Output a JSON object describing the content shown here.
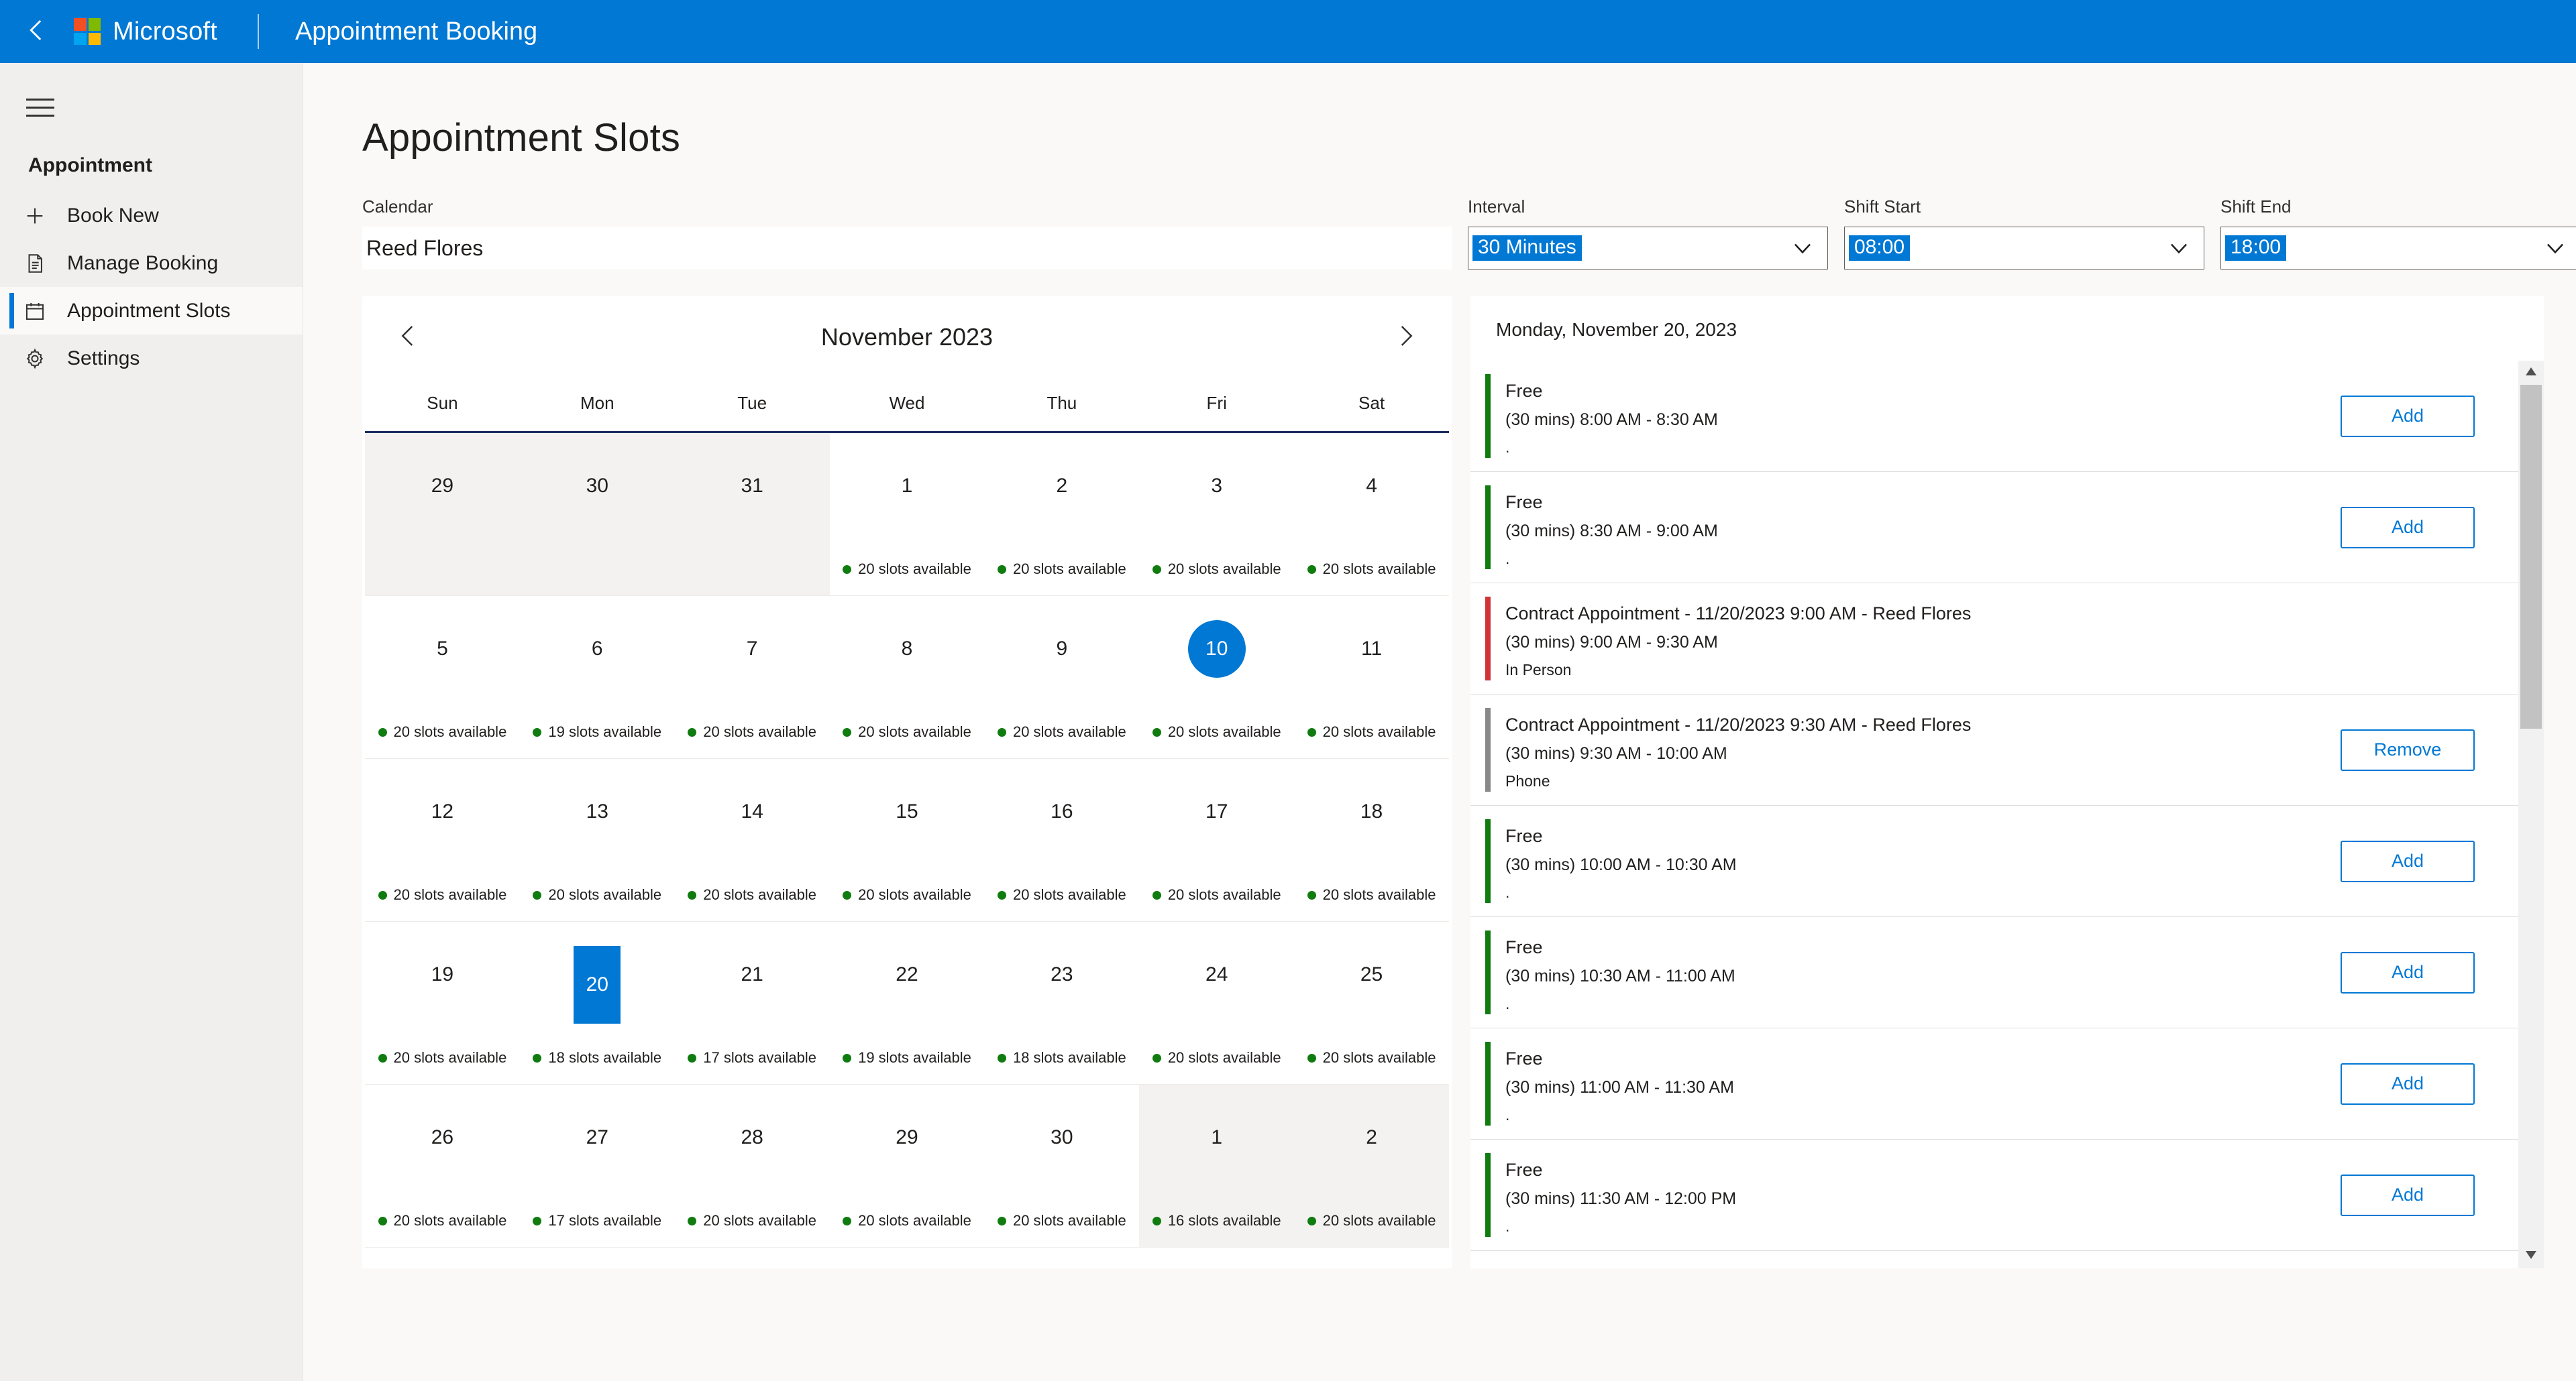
{
  "topbar": {
    "back_icon": "chevron-left-icon",
    "brand": "Microsoft",
    "app_title": "Appointment Booking"
  },
  "sidebar": {
    "menu_icon": "hamburger-icon",
    "heading": "Appointment",
    "items": [
      {
        "label": "Book New",
        "icon": "plus-icon",
        "active": false
      },
      {
        "label": "Manage Booking",
        "icon": "document-icon",
        "active": false
      },
      {
        "label": "Appointment Slots",
        "icon": "calendar-icon",
        "active": true
      },
      {
        "label": "Settings",
        "icon": "gear-icon",
        "active": false
      }
    ]
  },
  "page": {
    "title": "Appointment Slots"
  },
  "filters": {
    "calendar": {
      "label": "Calendar",
      "value": "Reed Flores"
    },
    "interval": {
      "label": "Interval",
      "value": "30 Minutes"
    },
    "shift_start": {
      "label": "Shift Start",
      "value": "08:00"
    },
    "shift_end": {
      "label": "Shift End",
      "value": "18:00"
    }
  },
  "calendar": {
    "prev_icon": "chevron-left-icon",
    "next_icon": "chevron-right-icon",
    "month_label": "November 2023",
    "day_names": [
      "Sun",
      "Mon",
      "Tue",
      "Wed",
      "Thu",
      "Fri",
      "Sat"
    ],
    "slots_suffix": "slots available",
    "weeks": [
      [
        {
          "day": "29",
          "other": true,
          "slots": null
        },
        {
          "day": "30",
          "other": true,
          "slots": null
        },
        {
          "day": "31",
          "other": true,
          "slots": null
        },
        {
          "day": "1",
          "other": false,
          "slots": "20 slots available"
        },
        {
          "day": "2",
          "other": false,
          "slots": "20 slots available"
        },
        {
          "day": "3",
          "other": false,
          "slots": "20 slots available"
        },
        {
          "day": "4",
          "other": false,
          "slots": "20 slots available"
        }
      ],
      [
        {
          "day": "5",
          "other": false,
          "slots": "20 slots available"
        },
        {
          "day": "6",
          "other": false,
          "slots": "19 slots available"
        },
        {
          "day": "7",
          "other": false,
          "slots": "20 slots available"
        },
        {
          "day": "8",
          "other": false,
          "slots": "20 slots available"
        },
        {
          "day": "9",
          "other": false,
          "slots": "20 slots available"
        },
        {
          "day": "10",
          "other": false,
          "slots": "20 slots available",
          "today": true
        },
        {
          "day": "11",
          "other": false,
          "slots": "20 slots available"
        }
      ],
      [
        {
          "day": "12",
          "other": false,
          "slots": "20 slots available"
        },
        {
          "day": "13",
          "other": false,
          "slots": "20 slots available"
        },
        {
          "day": "14",
          "other": false,
          "slots": "20 slots available"
        },
        {
          "day": "15",
          "other": false,
          "slots": "20 slots available"
        },
        {
          "day": "16",
          "other": false,
          "slots": "20 slots available"
        },
        {
          "day": "17",
          "other": false,
          "slots": "20 slots available"
        },
        {
          "day": "18",
          "other": false,
          "slots": "20 slots available"
        }
      ],
      [
        {
          "day": "19",
          "other": false,
          "slots": "20 slots available"
        },
        {
          "day": "20",
          "other": false,
          "slots": "18 slots available",
          "selected": true
        },
        {
          "day": "21",
          "other": false,
          "slots": "17 slots available"
        },
        {
          "day": "22",
          "other": false,
          "slots": "19 slots available"
        },
        {
          "day": "23",
          "other": false,
          "slots": "18 slots available"
        },
        {
          "day": "24",
          "other": false,
          "slots": "20 slots available"
        },
        {
          "day": "25",
          "other": false,
          "slots": "20 slots available"
        }
      ],
      [
        {
          "day": "26",
          "other": false,
          "slots": "20 slots available"
        },
        {
          "day": "27",
          "other": false,
          "slots": "17 slots available"
        },
        {
          "day": "28",
          "other": false,
          "slots": "20 slots available"
        },
        {
          "day": "29",
          "other": false,
          "slots": "20 slots available"
        },
        {
          "day": "30",
          "other": false,
          "slots": "20 slots available"
        },
        {
          "day": "1",
          "other": true,
          "slots": "16 slots available"
        },
        {
          "day": "2",
          "other": true,
          "slots": "20 slots available"
        }
      ]
    ]
  },
  "slots_panel": {
    "date_header": "Monday, November 20, 2023",
    "scroll_up_icon": "triangle-up-icon",
    "scroll_down_icon": "triangle-down-icon",
    "rows": [
      {
        "title": "Free",
        "time": "(30 mins) 8:00 AM - 8:30 AM",
        "mode": ".",
        "status": "free",
        "bar_color": "#107c10",
        "action": "Add"
      },
      {
        "title": "Free",
        "time": "(30 mins) 8:30 AM - 9:00 AM",
        "mode": ".",
        "status": "free",
        "bar_color": "#107c10",
        "action": "Add"
      },
      {
        "title": "Contract Appointment - 11/20/2023 9:00 AM  - Reed Flores",
        "time": "(30 mins) 9:00 AM - 9:30 AM",
        "mode": "In Person",
        "status": "booked",
        "bar_color": "#d13438",
        "action": null
      },
      {
        "title": "Contract Appointment - 11/20/2023 9:30 AM  - Reed Flores",
        "time": "(30 mins) 9:30 AM - 10:00 AM",
        "mode": "Phone",
        "status": "booked",
        "bar_color": "#8a8886",
        "action": "Remove"
      },
      {
        "title": "Free",
        "time": "(30 mins) 10:00 AM - 10:30 AM",
        "mode": ".",
        "status": "free",
        "bar_color": "#107c10",
        "action": "Add"
      },
      {
        "title": "Free",
        "time": "(30 mins) 10:30 AM - 11:00 AM",
        "mode": ".",
        "status": "free",
        "bar_color": "#107c10",
        "action": "Add"
      },
      {
        "title": "Free",
        "time": "(30 mins) 11:00 AM - 11:30 AM",
        "mode": ".",
        "status": "free",
        "bar_color": "#107c10",
        "action": "Add"
      },
      {
        "title": "Free",
        "time": "(30 mins) 11:30 AM - 12:00 PM",
        "mode": ".",
        "status": "free",
        "bar_color": "#107c10",
        "action": "Add"
      }
    ]
  },
  "colors": {
    "brand_blue": "#0078d4",
    "free_green": "#107c10",
    "booked_red": "#d13438",
    "booked_gray": "#8a8886"
  }
}
